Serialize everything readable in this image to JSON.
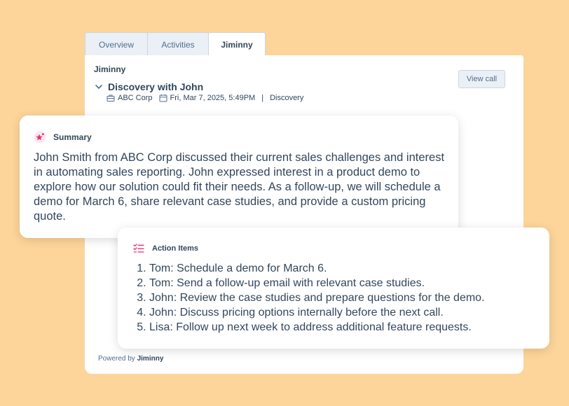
{
  "tabs": [
    {
      "label": "Overview"
    },
    {
      "label": "Activities"
    },
    {
      "label": "Jiminny"
    }
  ],
  "card": {
    "title": "Jiminny",
    "view_call_label": "View call",
    "meeting_title": "Discovery with John",
    "company": "ABC Corp",
    "datetime": "Fri, Mar 7, 2025, 5:49PM",
    "separator": "|",
    "stage": "Discovery",
    "powered_prefix": "Powered by",
    "powered_brand": "Jiminny"
  },
  "summary": {
    "label": "Summary",
    "text": "John Smith from ABC Corp discussed their current sales challenges and interest in automating sales reporting. John expressed interest in a product demo to explore how our solution could fit their needs. As a follow-up, we will schedule a demo for March 6, share relevant case studies, and provide a custom pricing quote."
  },
  "action_items": {
    "label": "Action Items",
    "items": [
      "Tom: Schedule a demo for March 6.",
      "Tom: Send a follow-up email with relevant case studies.",
      "John: Review the case studies and prepare questions for the demo.",
      "John: Discuss pricing options internally before the next call.",
      "Lisa: Follow up next week to address additional feature requests."
    ]
  },
  "icons": {
    "chevron": "chevron-down-icon",
    "company": "briefcase-icon",
    "calendar": "calendar-icon",
    "summary": "sparkle-star-icon",
    "actions": "checklist-icon"
  },
  "colors": {
    "background": "#FDD59A",
    "text": "#33475b",
    "accent_pink": "#e8336d",
    "button_bg": "#eaf0f6"
  }
}
